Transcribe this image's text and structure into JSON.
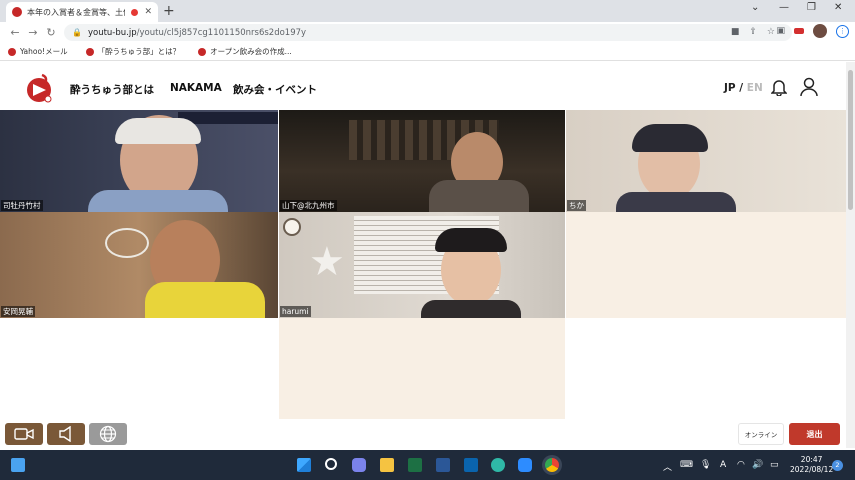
{
  "browser": {
    "tab_title": "本年の入賞者＆金賞等、土佐",
    "tab_close": "✕",
    "new_tab": "+",
    "url_host": "youtu-bu.jp",
    "url_path": "/youtu/cl5j857cg1101150nrs6s2do197y",
    "bookmarks": [
      "Yahoo!メール",
      "「酔うちゅう部」とは？",
      "オープン飲み会の作成..."
    ]
  },
  "site": {
    "nav": [
      "酔うちゅう部とは",
      "NAKAMA",
      "飲み会・イベント"
    ],
    "lang_jp": "JP",
    "lang_sep": " / ",
    "lang_en": "EN"
  },
  "participants": [
    {
      "name": "司牡丹竹村"
    },
    {
      "name": "山下@北九州市"
    },
    {
      "name": "ちか"
    },
    {
      "name": "安岡晃輔"
    },
    {
      "name": "harumi"
    }
  ],
  "controls": {
    "online_label": "オンライン",
    "exit_label": "退出"
  },
  "taskbar": {
    "time": "20:47",
    "date": "2022/08/12",
    "notification_count": "2",
    "ime": "A"
  }
}
